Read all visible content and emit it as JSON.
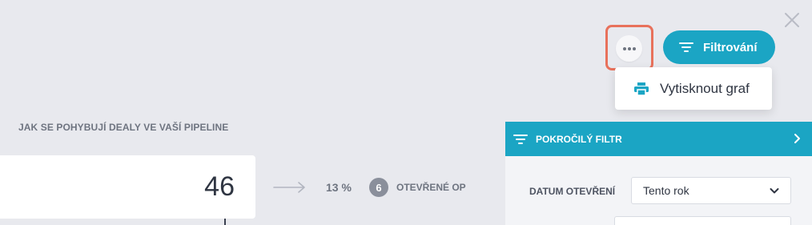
{
  "toolbar": {
    "filter_label": "Filtrování",
    "more_icon": "more-horizontal-icon",
    "close_icon": "close-icon"
  },
  "dropdown_menu": {
    "items": [
      {
        "label": "Vytisknout graf",
        "icon": "printer-icon"
      }
    ]
  },
  "pipeline": {
    "title": "JAK SE POHYBUJÍ DEALY VE VAŠÍ PIPELINE",
    "stage_value": "46",
    "conversion_percent": "13 %",
    "open_count": "6",
    "open_label": "OTEVŘENÉ OP"
  },
  "advanced_filter": {
    "title": "POKROČILÝ FILTR",
    "fields": [
      {
        "label": "DATUM OTEVŘENÍ",
        "value": "Tento rok"
      }
    ]
  },
  "colors": {
    "accent": "#1ba5c4",
    "highlight_border": "#e8715b",
    "background": "#e8e9ee"
  }
}
